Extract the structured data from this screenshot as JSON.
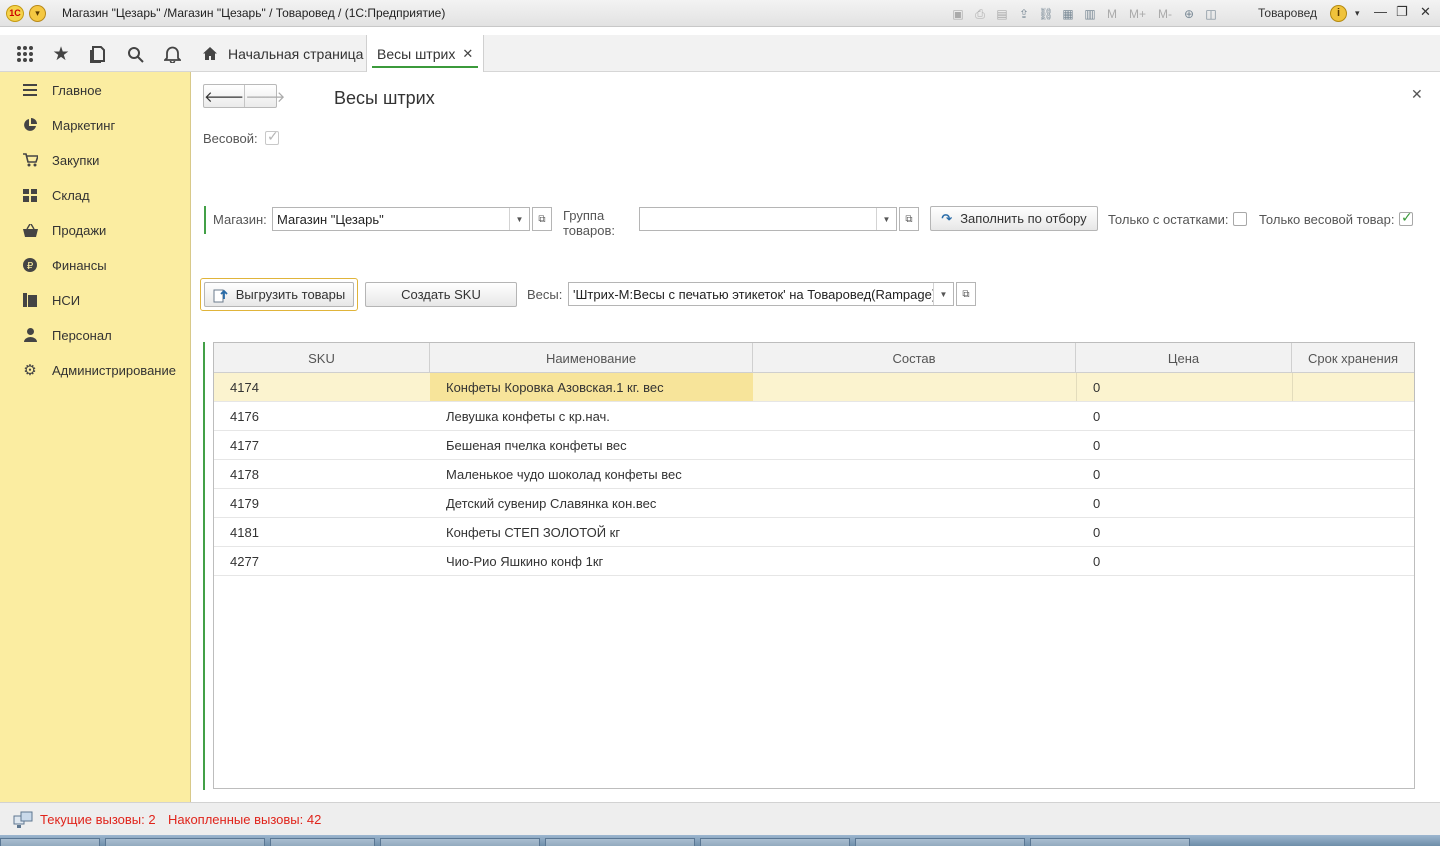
{
  "window": {
    "title": "Магазин \"Цезарь\" /Магазин \"Цезарь\" / Товаровед /  (1С:Предприятие)",
    "user": "Товаровед",
    "m_buttons": [
      "M",
      "M+",
      "M-"
    ]
  },
  "tabs": [
    {
      "label": "Начальная страница",
      "active": false
    },
    {
      "label": "Весы штрих",
      "active": true
    }
  ],
  "sidebar": {
    "items": [
      {
        "label": "Главное",
        "icon": "list-icon"
      },
      {
        "label": "Маркетинг",
        "icon": "pie-chart-icon"
      },
      {
        "label": "Закупки",
        "icon": "cart-icon"
      },
      {
        "label": "Склад",
        "icon": "warehouse-grid-icon"
      },
      {
        "label": "Продажи",
        "icon": "basket-icon"
      },
      {
        "label": "Финансы",
        "icon": "ruble-icon"
      },
      {
        "label": "НСИ",
        "icon": "book-icon"
      },
      {
        "label": "Персонал",
        "icon": "person-icon"
      },
      {
        "label": "Администрирование",
        "icon": "gear-icon"
      }
    ]
  },
  "form": {
    "title": "Весы штрих",
    "vesovoy_label": "Весовой:",
    "vesovoy_checked": true,
    "magazin_label": "Магазин:",
    "magazin_value": "Магазин \"Цезарь\"",
    "gruppa_label_1": "Группа",
    "gruppa_label_2": "товаров:",
    "gruppa_value": "",
    "fill_button": "Заполнить по отбору",
    "only_stock_label": "Только с остатками:",
    "only_stock_checked": false,
    "only_weight_label": "Только весовой товар:",
    "only_weight_checked": true,
    "upload_button": "Выгрузить товары",
    "create_sku_button": "Создать SKU",
    "scales_label": "Весы:",
    "scales_value": "'Штрих-М:Весы с печатью этикеток' на Товаровед(Rampage)"
  },
  "table": {
    "columns": [
      "SKU",
      "Наименование",
      "Состав",
      "Цена",
      "Срок хранения"
    ],
    "rows": [
      {
        "sku": "4174",
        "name": "Конфеты Коровка Азовская.1 кг. вес",
        "sostav": "",
        "price": "0",
        "srok": ""
      },
      {
        "sku": "4176",
        "name": "Левушка конфеты с кр.нач.",
        "sostav": "",
        "price": "0",
        "srok": ""
      },
      {
        "sku": "4177",
        "name": "Бешеная пчелка конфеты вес",
        "sostav": "",
        "price": "0",
        "srok": ""
      },
      {
        "sku": "4178",
        "name": "Маленькое чудо шоколад конфеты вес",
        "sostav": "",
        "price": "0",
        "srok": ""
      },
      {
        "sku": "4179",
        "name": "Детский сувенир Славянка кон.вес",
        "sostav": "",
        "price": "0",
        "srok": ""
      },
      {
        "sku": "4181",
        "name": "Конфеты СТЕП ЗОЛОТОЙ кг",
        "sostav": "",
        "price": "0",
        "srok": ""
      },
      {
        "sku": "4277",
        "name": "Чио-Рио Яшкино конф 1кг",
        "sostav": "",
        "price": "0",
        "srok": ""
      }
    ]
  },
  "status": {
    "current_calls": "Текущие вызовы: 2",
    "accumulated_calls": "Накопленные вызовы: 42"
  },
  "colors": {
    "sidebar_bg": "#fbeda1",
    "accent_green": "#43a047",
    "selected_row": "#fbf3cf",
    "status_text": "#e0241b"
  }
}
